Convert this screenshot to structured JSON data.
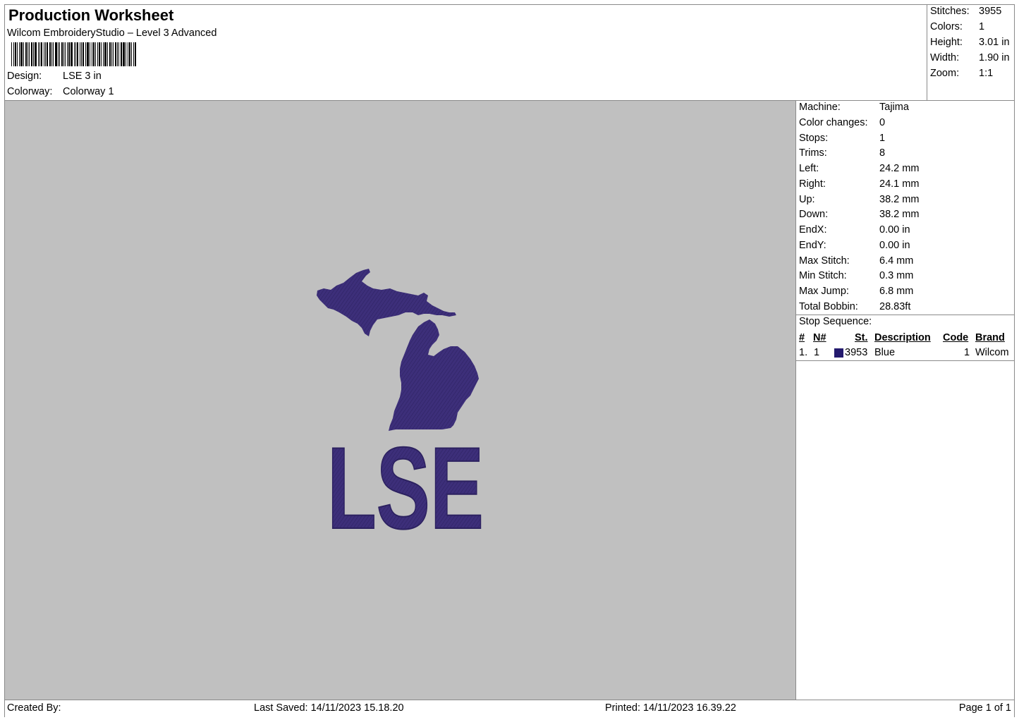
{
  "header": {
    "title": "Production Worksheet",
    "subtitle": "Wilcom EmbroideryStudio – Level 3 Advanced",
    "design_label": "Design:",
    "design_value": "LSE 3 in",
    "colorway_label": "Colorway:",
    "colorway_value": "Colorway 1"
  },
  "summary": [
    {
      "label": "Stitches:",
      "value": "3955"
    },
    {
      "label": "Colors:",
      "value": "1"
    },
    {
      "label": "Height:",
      "value": "3.01 in"
    },
    {
      "label": "Width:",
      "value": "1.90 in"
    },
    {
      "label": "Zoom:",
      "value": "1:1"
    }
  ],
  "details": [
    {
      "label": "Machine:",
      "value": "Tajima"
    },
    {
      "label": "Color changes:",
      "value": "0"
    },
    {
      "label": "Stops:",
      "value": "1"
    },
    {
      "label": "Trims:",
      "value": "8"
    },
    {
      "label": "Left:",
      "value": "24.2 mm"
    },
    {
      "label": "Right:",
      "value": "24.1 mm"
    },
    {
      "label": "Up:",
      "value": "38.2 mm"
    },
    {
      "label": "Down:",
      "value": "38.2 mm"
    },
    {
      "label": "EndX:",
      "value": "0.00 in"
    },
    {
      "label": "EndY:",
      "value": "0.00 in"
    },
    {
      "label": "Max Stitch:",
      "value": "6.4 mm"
    },
    {
      "label": "Min Stitch:",
      "value": "0.3 mm"
    },
    {
      "label": "Max Jump:",
      "value": "6.8 mm"
    },
    {
      "label": "Total Bobbin:",
      "value": "28.83ft"
    }
  ],
  "stop_sequence": {
    "label": "Stop Sequence:",
    "columns": [
      "#",
      "N#",
      "St.",
      "Description",
      "Code",
      "Brand"
    ],
    "rows": [
      {
        "num": "1.",
        "n": "1",
        "swatch_color": "#241a6e",
        "st": "3953",
        "description": "Blue",
        "code": "1",
        "brand": "Wilcom"
      }
    ]
  },
  "design": {
    "text": "LSE",
    "thread_color": "#3d2f7a"
  },
  "footer": {
    "created_by": "Created By:",
    "last_saved": "Last Saved: 14/11/2023 15.18.20",
    "printed": "Printed: 14/11/2023 16.39.22",
    "page": "Page 1 of 1"
  }
}
